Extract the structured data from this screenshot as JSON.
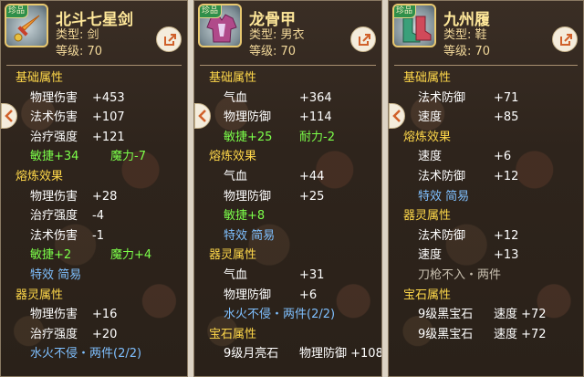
{
  "panels": [
    {
      "rarity_badge": "珍品",
      "icon": "sword-icon",
      "name": "北斗七星剑",
      "type": "类型: 剑",
      "level": "等级: 70",
      "rows": [
        {
          "kind": "sec",
          "text": "基础属性"
        },
        {
          "kind": "attr",
          "label": "物理伤害",
          "value": "+453"
        },
        {
          "kind": "attr",
          "label": "法术伤害",
          "value": "+107"
        },
        {
          "kind": "attr",
          "label": "治疗强度",
          "value": "+121"
        },
        {
          "kind": "green",
          "a": "敏捷+34",
          "b": "魔力-7"
        },
        {
          "kind": "sec",
          "text": "熔炼效果"
        },
        {
          "kind": "attr",
          "label": "物理伤害",
          "value": "+28"
        },
        {
          "kind": "attr",
          "label": "治疗强度",
          "value": "-4"
        },
        {
          "kind": "attr",
          "label": "法术伤害",
          "value": "-1"
        },
        {
          "kind": "green",
          "a": "敏捷+2",
          "b": "魔力+4"
        },
        {
          "kind": "blue",
          "text": "特效 简易"
        },
        {
          "kind": "sec",
          "text": "器灵属性"
        },
        {
          "kind": "attr",
          "label": "物理伤害",
          "value": "+16"
        },
        {
          "kind": "attr",
          "label": "治疗强度",
          "value": "+20"
        },
        {
          "kind": "blue",
          "text": "水火不侵・两件(2/2)"
        }
      ]
    },
    {
      "rarity_badge": "珍品",
      "icon": "armor-icon",
      "name": "龙骨甲",
      "type": "类型: 男衣",
      "level": "等级: 70",
      "rows": [
        {
          "kind": "sec",
          "text": "基础属性"
        },
        {
          "kind": "attr",
          "label": "气血",
          "value": "+364"
        },
        {
          "kind": "attr",
          "label": "物理防御",
          "value": "+114"
        },
        {
          "kind": "green",
          "a": "敏捷+25",
          "b": "耐力-2"
        },
        {
          "kind": "sec",
          "text": "熔炼效果"
        },
        {
          "kind": "attr",
          "label": "气血",
          "value": "+44"
        },
        {
          "kind": "attr",
          "label": "物理防御",
          "value": "+25"
        },
        {
          "kind": "green",
          "a": "敏捷+8",
          "b": ""
        },
        {
          "kind": "blue",
          "text": "特效 简易"
        },
        {
          "kind": "sec",
          "text": "器灵属性"
        },
        {
          "kind": "attr",
          "label": "气血",
          "value": "+31"
        },
        {
          "kind": "attr",
          "label": "物理防御",
          "value": "+6"
        },
        {
          "kind": "blue",
          "text": "水火不侵・两件(2/2)"
        },
        {
          "kind": "sec",
          "text": "宝石属性"
        },
        {
          "kind": "gem",
          "label": "9级月亮石",
          "value": "物理防御 +108"
        }
      ]
    },
    {
      "rarity_badge": "珍品",
      "icon": "boots-icon",
      "name": "九州履",
      "type": "类型: 鞋",
      "level": "等级: 70",
      "rows": [
        {
          "kind": "sec",
          "text": "基础属性"
        },
        {
          "kind": "attr",
          "label": "法术防御",
          "value": "+71"
        },
        {
          "kind": "attr",
          "label": "速度",
          "value": "+85"
        },
        {
          "kind": "sec",
          "text": "熔炼效果"
        },
        {
          "kind": "attr",
          "label": "速度",
          "value": "+6"
        },
        {
          "kind": "attr",
          "label": "法术防御",
          "value": "+12"
        },
        {
          "kind": "blue",
          "text": "特效 简易"
        },
        {
          "kind": "sec",
          "text": "器灵属性"
        },
        {
          "kind": "attr",
          "label": "法术防御",
          "value": "+12"
        },
        {
          "kind": "attr",
          "label": "速度",
          "value": "+13"
        },
        {
          "kind": "dur",
          "text": "刀枪不入・两件"
        },
        {
          "kind": "sec",
          "text": "宝石属性"
        },
        {
          "kind": "gem",
          "label": "9级黑宝石",
          "value": "速度 +72"
        },
        {
          "kind": "gem",
          "label": "9级黑宝石",
          "value": "速度 +72"
        }
      ]
    }
  ],
  "colors": {
    "section": "#ffd84a",
    "attribute": "#ffffff",
    "bonus": "#7cff4a",
    "set_effect": "#7fc0ff",
    "inactive_set": "#c9c0b0",
    "title": "#ffe89a"
  }
}
